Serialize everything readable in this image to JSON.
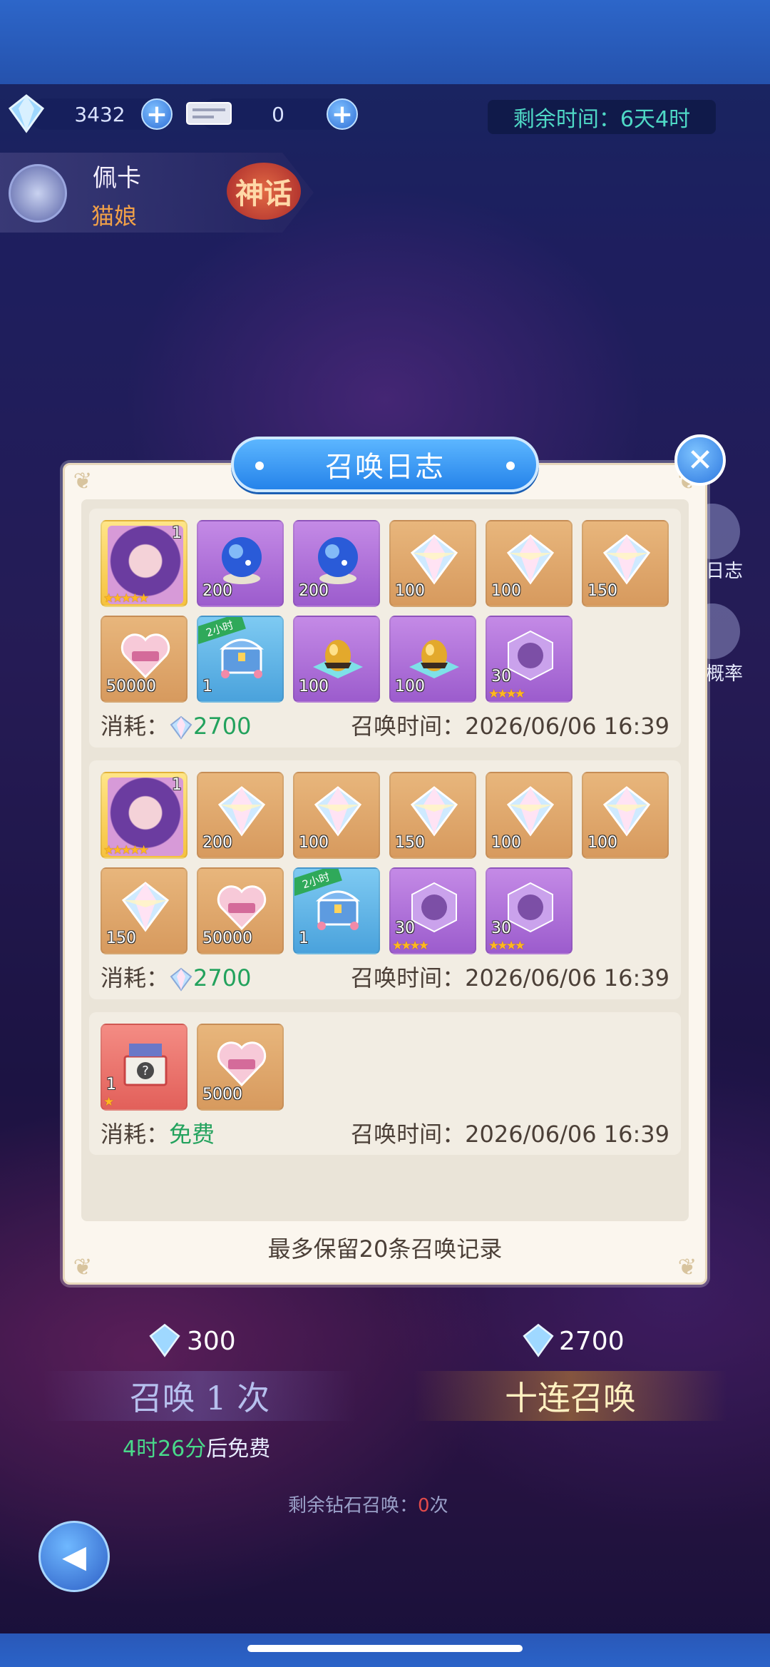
{
  "colors": {
    "accent_blue": "#2583ea",
    "cost_green": "#23a25d",
    "text_brown": "#4b3f37",
    "time_teal": "#4fd9c6",
    "tier_orange": "#f0a048"
  },
  "top_bar": {
    "gem_count": "3432",
    "ticket_count": "0",
    "remaining_time": "剩余时间：6天4时"
  },
  "hero": {
    "name": "佩卡",
    "race": "猫娘",
    "tier": "神话"
  },
  "side_buttons": {
    "log": "日志",
    "rate": "概率"
  },
  "background_summon": {
    "single_cost": "300",
    "ten_cost": "2700",
    "single_label": "召唤 1 次",
    "ten_label": "十连召唤",
    "free_timer": "4时26分",
    "free_suffix": "后免费",
    "remaining_prefix": "剩余钻石召唤：",
    "remaining_count": "0",
    "remaining_suffix": "次"
  },
  "dialog": {
    "title": "召唤日志",
    "footer": "最多保留20条召唤记录",
    "cost_label": "消耗：",
    "time_label": "召唤时间：",
    "records": [
      {
        "cost": "2700",
        "time": "2026/06/06 16:39",
        "items": [
          {
            "type": "hero-portrait",
            "count": "1",
            "stars": "★★★★★"
          },
          {
            "type": "crystal-orb-icon",
            "count": "200",
            "stars": ""
          },
          {
            "type": "crystal-orb-icon",
            "count": "200",
            "stars": ""
          },
          {
            "type": "rainbow-gem-icon",
            "count": "100",
            "stars": ""
          },
          {
            "type": "rainbow-gem-icon",
            "count": "100",
            "stars": ""
          },
          {
            "type": "rainbow-gem-icon",
            "count": "150",
            "stars": ""
          },
          {
            "type": "exp-heart-icon",
            "count": "50000",
            "stars": ""
          },
          {
            "type": "chest-icon",
            "count": "1",
            "stars": "",
            "tag": "2小时"
          },
          {
            "type": "golden-egg-icon",
            "count": "100",
            "stars": ""
          },
          {
            "type": "golden-egg-icon",
            "count": "100",
            "stars": ""
          },
          {
            "type": "shard-cube-icon",
            "count": "30",
            "stars": "★★★★"
          }
        ]
      },
      {
        "cost": "2700",
        "time": "2026/06/06 16:39",
        "items": [
          {
            "type": "hero-portrait",
            "count": "1",
            "stars": "★★★★★"
          },
          {
            "type": "rainbow-gem-icon",
            "count": "200",
            "stars": ""
          },
          {
            "type": "rainbow-gem-icon",
            "count": "100",
            "stars": ""
          },
          {
            "type": "rainbow-gem-icon",
            "count": "150",
            "stars": ""
          },
          {
            "type": "rainbow-gem-icon",
            "count": "100",
            "stars": ""
          },
          {
            "type": "rainbow-gem-icon",
            "count": "100",
            "stars": ""
          },
          {
            "type": "rainbow-gem-icon",
            "count": "150",
            "stars": ""
          },
          {
            "type": "exp-heart-icon",
            "count": "50000",
            "stars": ""
          },
          {
            "type": "chest-icon",
            "count": "1",
            "stars": "",
            "tag": "2小时"
          },
          {
            "type": "shard-cube-icon",
            "count": "30",
            "stars": "★★★★"
          },
          {
            "type": "shard-cube-icon",
            "count": "30",
            "stars": "★★★★"
          }
        ]
      },
      {
        "cost": "免费",
        "time": "2026/06/06 16:39",
        "items": [
          {
            "type": "mystery-box-icon",
            "count": "1",
            "stars": "★"
          },
          {
            "type": "exp-heart-icon",
            "count": "5000",
            "stars": ""
          }
        ]
      }
    ]
  }
}
